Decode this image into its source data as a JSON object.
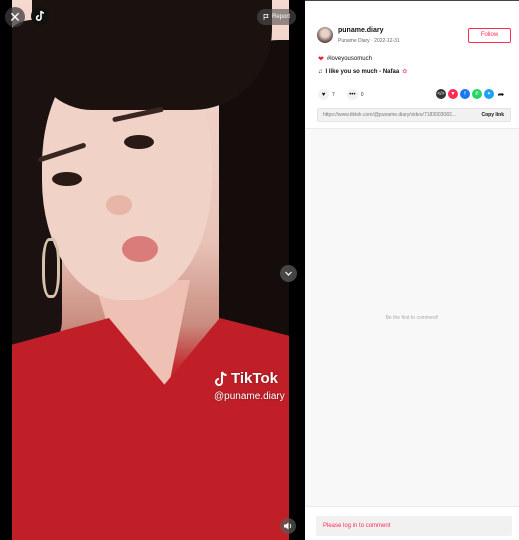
{
  "video": {
    "report_label": "Report",
    "watermark_brand": "TikTok",
    "watermark_handle": "@puname.diary"
  },
  "author": {
    "username": "puname.diary",
    "display_name": "Puname Diary",
    "date": "2022-12-31",
    "follow_label": "Follow"
  },
  "post": {
    "caption": "#loveyousomuch",
    "music": "I like you so much - Nafaa"
  },
  "stats": {
    "likes": "7",
    "comments": "0"
  },
  "share": {
    "link": "https://www.tiktok.com/@puname.diary/video/7183003082...",
    "copy_label": "Copy link",
    "icons": [
      "embed-icon",
      "tiktok-friends-icon",
      "facebook-icon",
      "whatsapp-icon",
      "twitter-icon",
      "share-arrow-icon"
    ]
  },
  "comments": {
    "empty_text": "Be the first to comment!"
  },
  "footer": {
    "login_prompt": "Please log in to comment"
  },
  "colors": {
    "accent": "#fe2c55"
  }
}
